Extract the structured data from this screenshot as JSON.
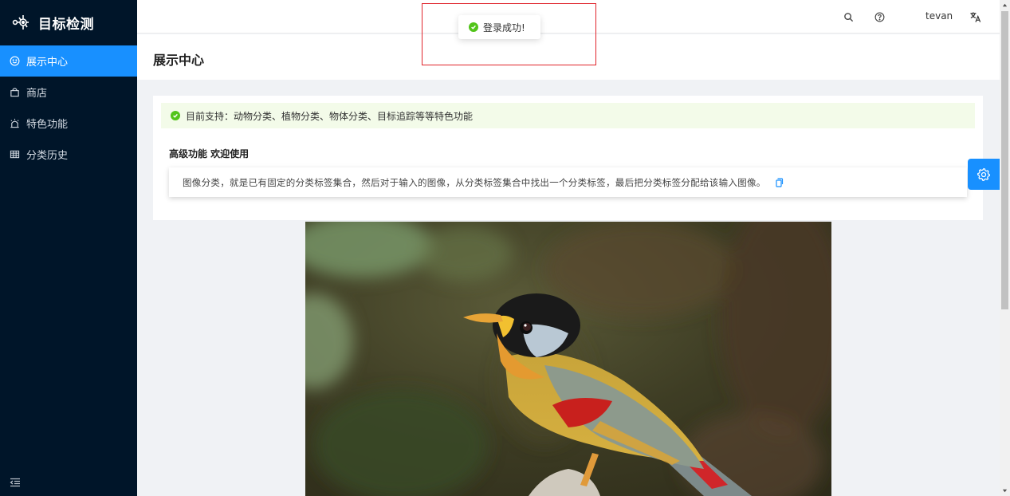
{
  "app": {
    "title": "目标检测"
  },
  "sidebar": {
    "items": [
      {
        "label": "展示中心",
        "icon": "smile-icon",
        "active": true
      },
      {
        "label": "商店",
        "icon": "shopping-bag-icon",
        "active": false
      },
      {
        "label": "特色功能",
        "icon": "alarm-icon",
        "active": false
      },
      {
        "label": "分类历史",
        "icon": "table-icon",
        "active": false
      }
    ]
  },
  "header": {
    "username": "tevan",
    "icons": [
      "search-icon",
      "help-icon",
      "translate-icon"
    ]
  },
  "page": {
    "title": "展示中心"
  },
  "content": {
    "support_text": "目前支持：动物分类、植物分类、物体分类、目标追踪等等特色功能",
    "advanced_title": "高级功能 欢迎使用",
    "description": "图像分类，就是已有固定的分类标签集合，然后对于输入的图像，从分类标签集合中找出一个分类标签，最后把分类标签分配给该输入图像。"
  },
  "toast": {
    "message": "登录成功!"
  },
  "colors": {
    "sidebar_bg": "#001529",
    "accent": "#1890ff",
    "success": "#52c41a",
    "highlight_border": "#e0242b"
  }
}
